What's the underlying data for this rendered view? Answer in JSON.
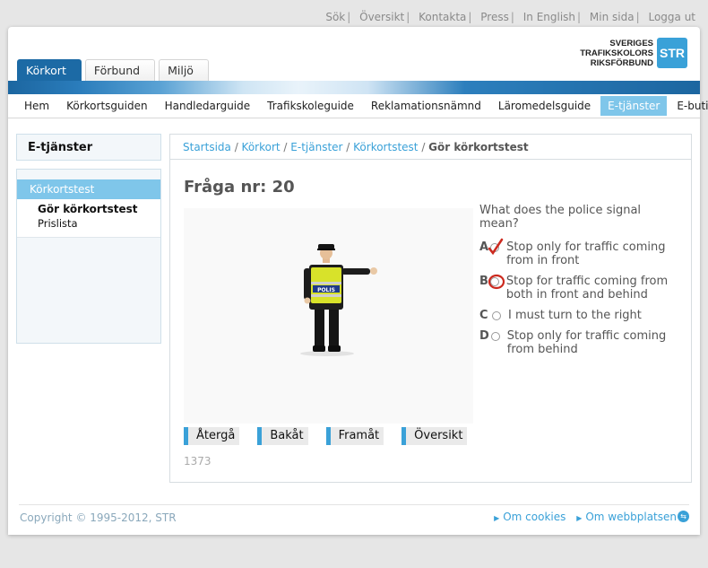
{
  "top_links": [
    "Sök",
    "Översikt",
    "Kontakta",
    "Press",
    "In English",
    "Min sida",
    "Logga ut"
  ],
  "logo": {
    "line1": "SVERIGES",
    "line2": "TRAFIKSKOLORS",
    "line3": "RIKSFÖRBUND",
    "box": "STR"
  },
  "tabs": [
    "Körkort",
    "Förbund",
    "Miljö"
  ],
  "main_nav": [
    "Hem",
    "Körkortsguiden",
    "Handledarguide",
    "Trafikskoleguide",
    "Reklamationsnämnd",
    "Läromedelsguide",
    "E-tjänster",
    "E-butik"
  ],
  "sidebar": {
    "title": "E-tjänster",
    "head": "Körkortstest",
    "sub1": "Gör körkortstest",
    "sub2": "Prislista"
  },
  "breadcrumb": {
    "items": [
      "Startsida",
      "Körkort",
      "E-tjänster",
      "Körkortstest"
    ],
    "current": "Gör körkortstest"
  },
  "question": {
    "title": "Fråga nr: 20",
    "text": "What does the police signal mean?",
    "options": [
      {
        "letter": "A",
        "text": "Stop only for traffic coming from in front"
      },
      {
        "letter": "B",
        "text": "Stop for traffic coming from both in front and behind"
      },
      {
        "letter": "C",
        "text": "I must turn to the right"
      },
      {
        "letter": "D",
        "text": "Stop only for traffic coming from behind"
      }
    ],
    "police_vest_text": "POLIS",
    "id": "1373"
  },
  "buttons": {
    "back": "Återgå",
    "prev": "Bakåt",
    "next": "Framåt",
    "overview": "Översikt"
  },
  "footer": {
    "copyright": "Copyright © 1995-2012, STR",
    "link1": "Om cookies",
    "link2": "Om webbplatsen"
  },
  "colors": {
    "accent": "#3aa1d8",
    "nav_active": "#7fc6ea",
    "tab_active": "#1c6aa5",
    "mark_red": "#cc2a1f"
  }
}
